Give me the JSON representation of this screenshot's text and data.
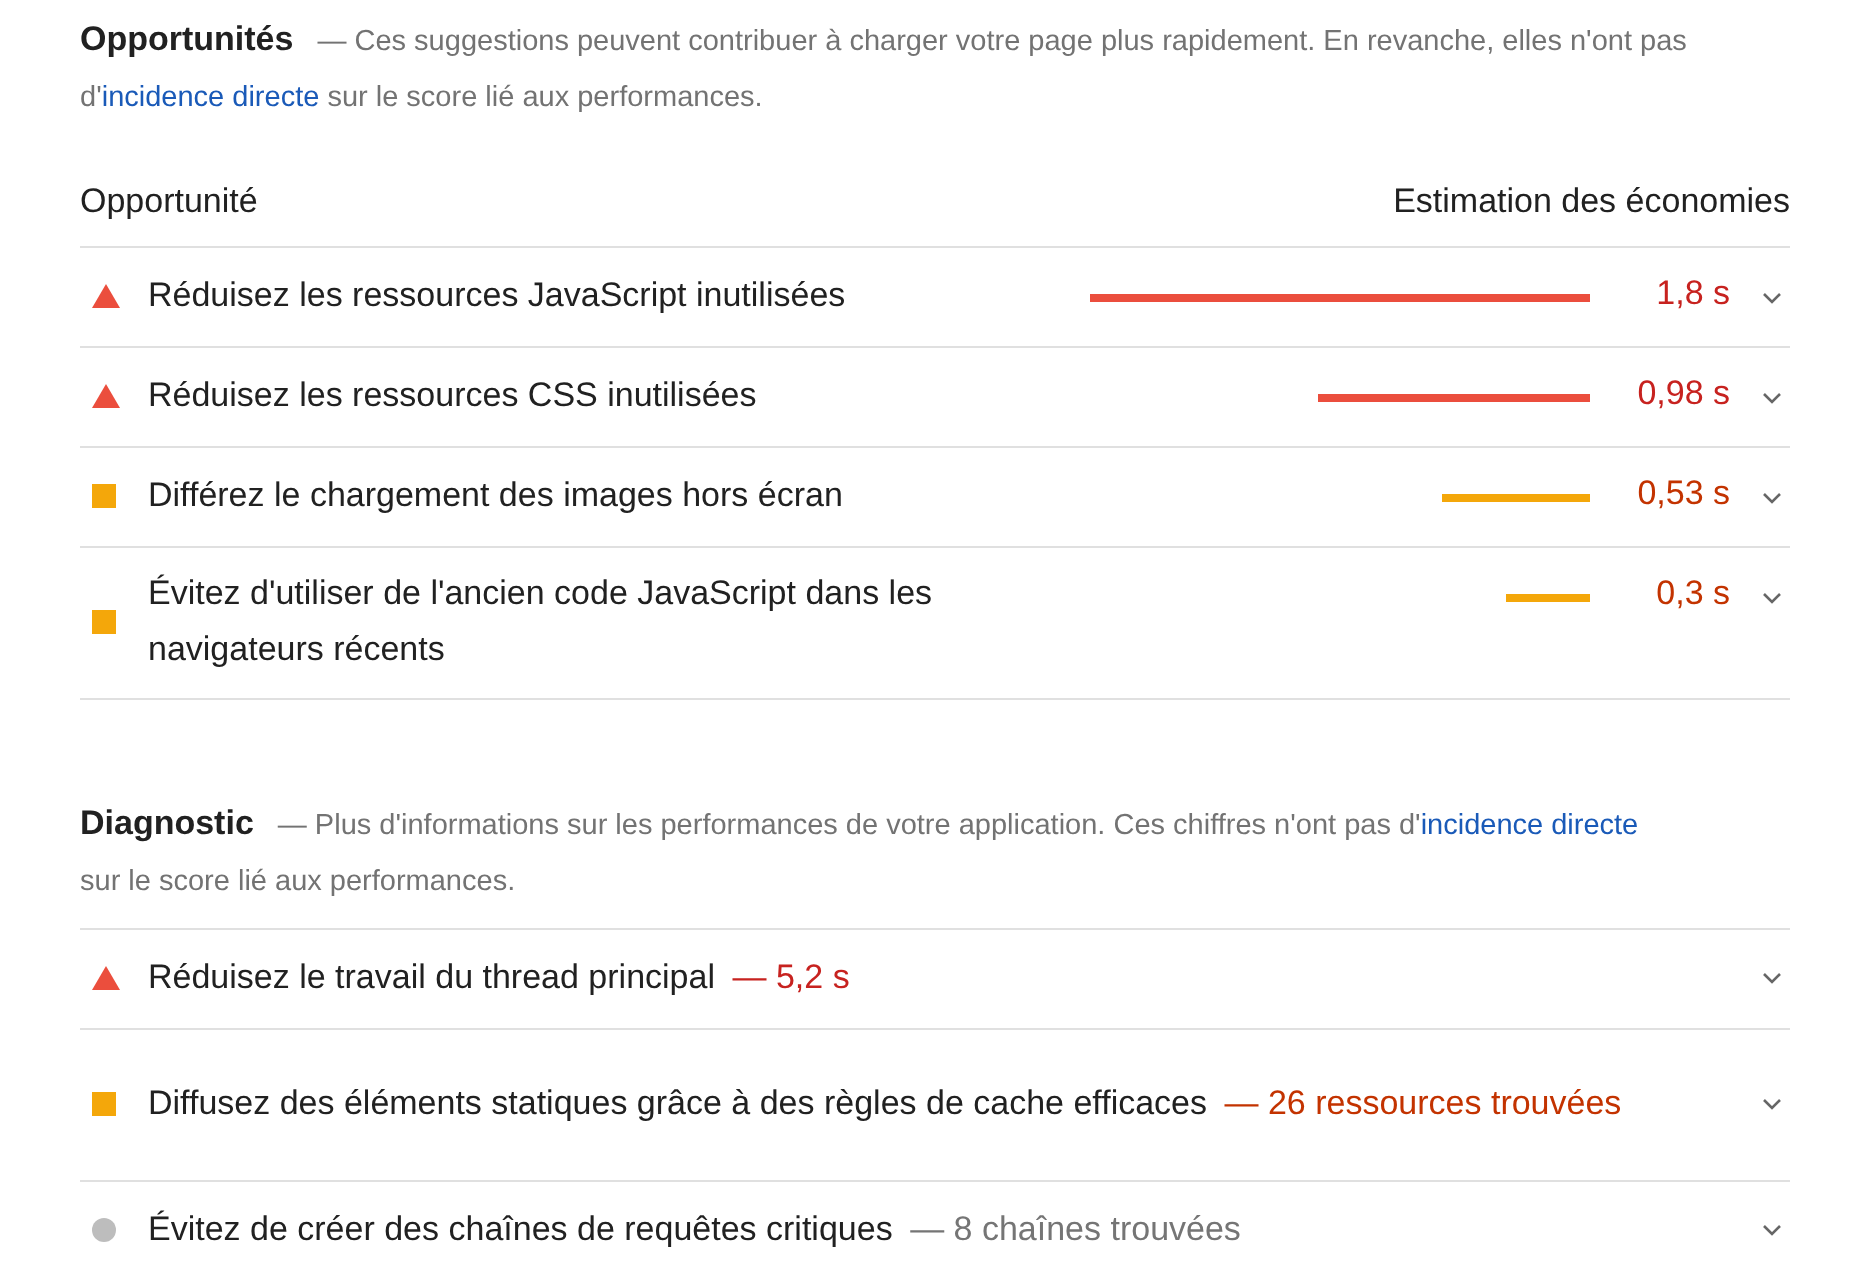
{
  "opportunities": {
    "title": "Opportunités",
    "description_before": "— Ces suggestions peuvent contribuer à charger votre page plus rapidement. En revanche, elles n'ont pas d'",
    "link": "incidence directe",
    "description_after": " sur le score lié aux performances.",
    "column_1": "Opportunité",
    "column_2": "Estimation des économies",
    "rows": [
      {
        "kind": "fail",
        "title": "Réduisez les ressources JavaScript inutilisées",
        "value": "1,8 s",
        "expanded": false
      },
      {
        "kind": "fail",
        "title": "Réduisez les ressources CSS inutilisées",
        "value": "0,98 s",
        "expanded": false
      },
      {
        "kind": "average",
        "title": "Différez le chargement des images hors écran",
        "value": "0,53 s",
        "expanded": false
      },
      {
        "kind": "average",
        "title": "Évitez d'utiliser de l'ancien code JavaScript dans les navigateurs récents",
        "value": "0,3 s",
        "expanded": false
      }
    ]
  },
  "diagnostic": {
    "title": "Diagnostic",
    "description_before": "— Plus d'informations sur les performances de votre application. Ces chiffres n'ont pas d'",
    "link": "incidence directe",
    "description_after": " sur le score lié aux performances.",
    "rows": [
      {
        "kind": "fail",
        "title": "Réduisez le travail du thread principal",
        "value": "— 5,2 s",
        "expanded": false
      },
      {
        "kind": "average",
        "title": "Diffusez des éléments statiques grâce à des règles de cache efficaces",
        "value": "— 26 ressources trouvées",
        "expanded": false
      },
      {
        "kind": "info",
        "title": "Évitez de créer des chaînes de requêtes critiques",
        "value": "— 8 chaînes trouvées",
        "expanded": false
      }
    ]
  }
}
